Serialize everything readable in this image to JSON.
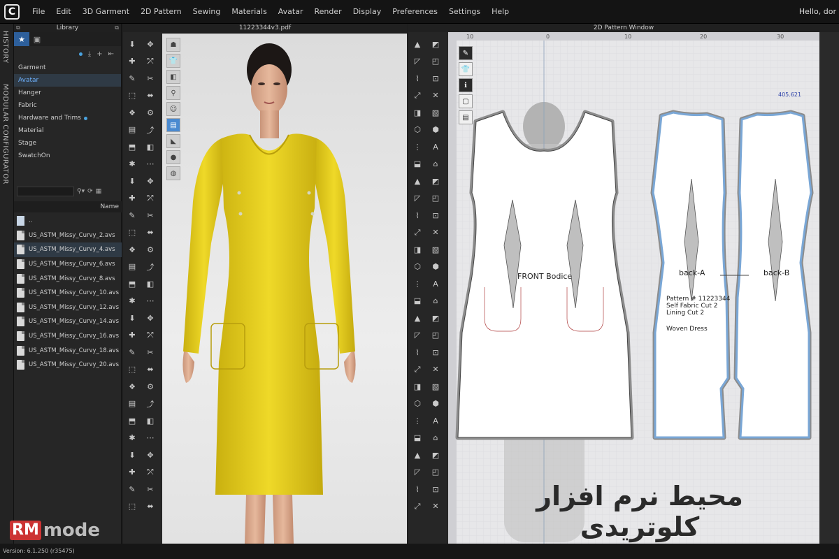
{
  "app": {
    "logo_letter": "C",
    "menu": [
      "File",
      "Edit",
      "3D Garment",
      "2D Pattern",
      "Sewing",
      "Materials",
      "Avatar",
      "Render",
      "Display",
      "Preferences",
      "Settings",
      "Help"
    ],
    "greeting": "Hello, dor"
  },
  "side_tabs": {
    "history": "HISTORY",
    "modular": "MODULAR CONFIGURATOR"
  },
  "library": {
    "title": "Library",
    "categories": [
      {
        "label": "Garment",
        "active": false,
        "dot": false
      },
      {
        "label": "Avatar",
        "active": true,
        "dot": false
      },
      {
        "label": "Hanger",
        "active": false,
        "dot": false
      },
      {
        "label": "Fabric",
        "active": false,
        "dot": false
      },
      {
        "label": "Hardware and Trims",
        "active": false,
        "dot": true
      },
      {
        "label": "Material",
        "active": false,
        "dot": false
      },
      {
        "label": "Stage",
        "active": false,
        "dot": false
      },
      {
        "label": "SwatchOn",
        "active": false,
        "dot": false
      }
    ],
    "name_header": "Name",
    "files": [
      {
        "label": "..",
        "selected": false,
        "folder": true
      },
      {
        "label": "US_ASTM_Missy_Curvy_2.avs",
        "selected": false,
        "folder": false
      },
      {
        "label": "US_ASTM_Missy_Curvy_4.avs",
        "selected": true,
        "folder": false
      },
      {
        "label": "US_ASTM_Missy_Curvy_6.avs",
        "selected": false,
        "folder": false
      },
      {
        "label": "US_ASTM_Missy_Curvy_8.avs",
        "selected": false,
        "folder": false
      },
      {
        "label": "US_ASTM_Missy_Curvy_10.avs",
        "selected": false,
        "folder": false
      },
      {
        "label": "US_ASTM_Missy_Curvy_12.avs",
        "selected": false,
        "folder": false
      },
      {
        "label": "US_ASTM_Missy_Curvy_14.avs",
        "selected": false,
        "folder": false
      },
      {
        "label": "US_ASTM_Missy_Curvy_16.avs",
        "selected": false,
        "folder": false
      },
      {
        "label": "US_ASTM_Missy_Curvy_18.avs",
        "selected": false,
        "folder": false
      },
      {
        "label": "US_ASTM_Missy_Curvy_20.avs",
        "selected": false,
        "folder": false
      }
    ]
  },
  "window3d": {
    "title": "11223344v3.pdf"
  },
  "window2d": {
    "title": "2D Pattern Window",
    "ruler_labels": [
      "10",
      "0",
      "10",
      "20",
      "30"
    ],
    "coordinate": "405.621",
    "front_label": "FRONT Bodice",
    "back_a_label": "back-A",
    "back_b_label": "back-B",
    "pattern_notes": [
      "Pattern # 11223344",
      "Self Fabric Cut 2",
      "Lining Cut 2"
    ],
    "woven_label": "Woven Dress"
  },
  "overlay_caption": "محیط نرم افزار کلوتریدی",
  "brand": {
    "rm": "RM",
    "mode": "mode"
  },
  "status": {
    "version": "Version: 6.1.250 (r35475)"
  },
  "colors": {
    "dress": "#e8d21c",
    "pattern_outline": "#7aa7d6",
    "selection": "#2f3a45",
    "accent": "#2d5f9b"
  }
}
